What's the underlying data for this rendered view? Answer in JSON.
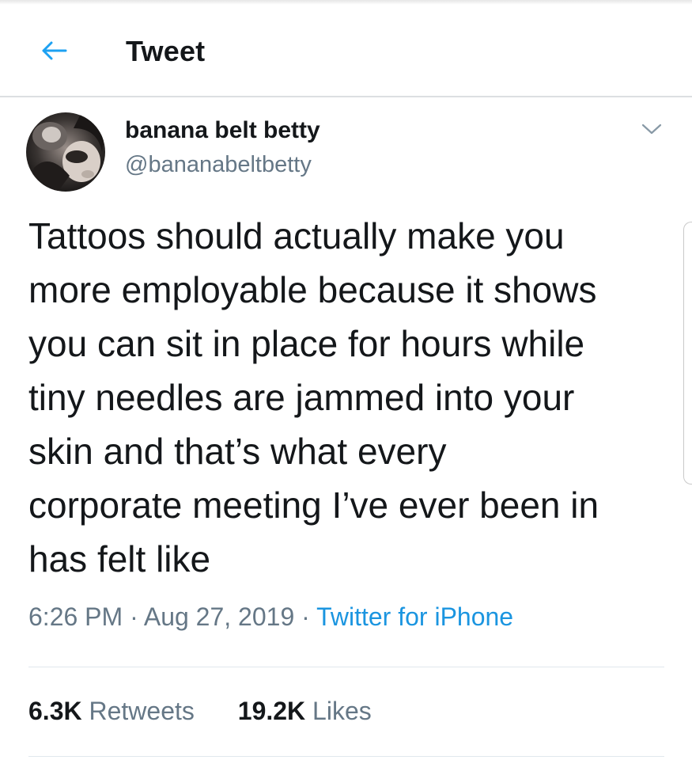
{
  "header": {
    "back_icon": "arrow-left-icon",
    "title": "Tweet"
  },
  "tweet": {
    "author": {
      "name": "banana belt betty",
      "handle": "@bananabeltbetty",
      "avatar": "profile-photo"
    },
    "menu_icon": "chevron-down-icon",
    "text_lines": [
      "Tattoos should actually make you",
      "more employable because it shows",
      "you can sit in place for hours while",
      "tiny needles are jammed into your",
      "skin and that’s what every",
      "corporate meeting I’ve ever been in",
      "has felt like"
    ],
    "time": "6:26 PM",
    "date": "Aug 27, 2019",
    "separator": "·",
    "source": "Twitter for iPhone",
    "stats": {
      "retweets_count": "6.3K",
      "retweets_label": "Retweets",
      "likes_count": "19.2K",
      "likes_label": "Likes"
    }
  },
  "colors": {
    "accent": "#1b95e0",
    "text_primary": "#14171a",
    "text_secondary": "#657786",
    "divider": "#e1e8ed"
  }
}
